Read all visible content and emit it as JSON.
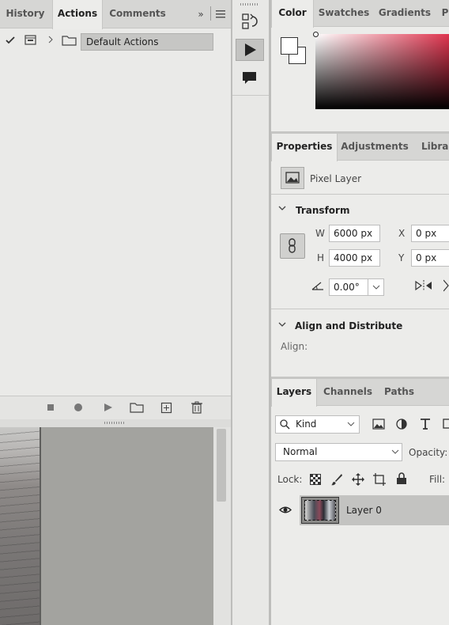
{
  "actions_panel": {
    "tabs": [
      {
        "label": "History"
      },
      {
        "label": "Actions"
      },
      {
        "label": "Comments"
      }
    ],
    "set_name": "Default Actions"
  },
  "color_panel": {
    "tabs": [
      {
        "label": "Color"
      },
      {
        "label": "Swatches"
      },
      {
        "label": "Gradients"
      },
      {
        "label": "P"
      }
    ],
    "foreground": "#ffffff",
    "background": "#ffffff",
    "hue": "#e0354f"
  },
  "properties_panel": {
    "tabs": [
      {
        "label": "Properties"
      },
      {
        "label": "Adjustments"
      },
      {
        "label": "Librar"
      }
    ],
    "layer_type": "Pixel Layer",
    "transform_title": "Transform",
    "w_label": "W",
    "w_value": "6000 px",
    "h_label": "H",
    "h_value": "4000 px",
    "x_label": "X",
    "x_value": "0 px",
    "y_label": "Y",
    "y_value": "0 px",
    "angle_value": "0.00°",
    "align_title": "Align and Distribute",
    "align_label": "Align:"
  },
  "layers_panel": {
    "tabs": [
      {
        "label": "Layers"
      },
      {
        "label": "Channels"
      },
      {
        "label": "Paths"
      }
    ],
    "filter_kind": "Kind",
    "blend_mode": "Normal",
    "opacity_label": "Opacity:",
    "lock_label": "Lock:",
    "fill_label": "Fill:",
    "layers": [
      {
        "name": "Layer 0",
        "visible": true
      }
    ]
  }
}
